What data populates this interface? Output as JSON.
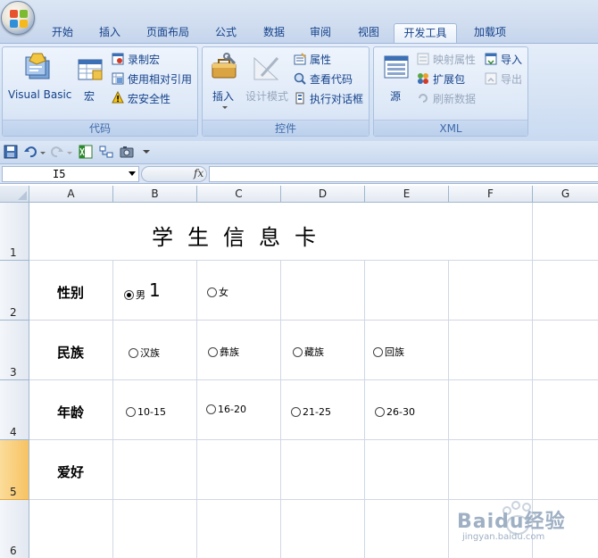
{
  "ribbon_tabs": [
    "开始",
    "插入",
    "页面布局",
    "公式",
    "数据",
    "审阅",
    "视图",
    "开发工具",
    "加载项"
  ],
  "active_tab": "开发工具",
  "groups": {
    "code": {
      "label": "代码",
      "visual_basic": "Visual Basic",
      "macro": "宏",
      "record_macro": "录制宏",
      "relative_ref": "使用相对引用",
      "macro_security": "宏安全性"
    },
    "controls": {
      "label": "控件",
      "insert": "插入",
      "design_mode": "设计模式",
      "properties": "属性",
      "view_code": "查看代码",
      "run_dialog": "执行对话框"
    },
    "xml": {
      "label": "XML",
      "source": "源",
      "map_properties": "映射属性",
      "expansion_packs": "扩展包",
      "refresh_data": "刷新数据",
      "import": "导入",
      "export": "导出"
    }
  },
  "formula_bar": {
    "name_box": "I5",
    "fx": "fx",
    "formula": ""
  },
  "columns": [
    "A",
    "B",
    "C",
    "D",
    "E",
    "F",
    "G"
  ],
  "rows": [
    "1",
    "2",
    "3",
    "4",
    "5",
    "6"
  ],
  "selected_row": "5",
  "sheet": {
    "title": "学生信息卡",
    "gender": {
      "label": "性别",
      "options": [
        "男",
        "女"
      ],
      "selected": "男",
      "linked_value": "1"
    },
    "ethnicity": {
      "label": "民族",
      "options": [
        "汉族",
        "彝族",
        "藏族",
        "回族"
      ]
    },
    "age": {
      "label": "年龄",
      "options": [
        "10-15",
        "16-20",
        "21-25",
        "26-30"
      ]
    },
    "hobby": {
      "label": "爱好"
    }
  },
  "watermark": {
    "text": "Baidu经验",
    "url": "jingyan.baidu.com"
  },
  "colors": {
    "selected_row_header": "#f7c262",
    "ribbon_text": "#15428b",
    "gridline": "#d0d7e5"
  }
}
